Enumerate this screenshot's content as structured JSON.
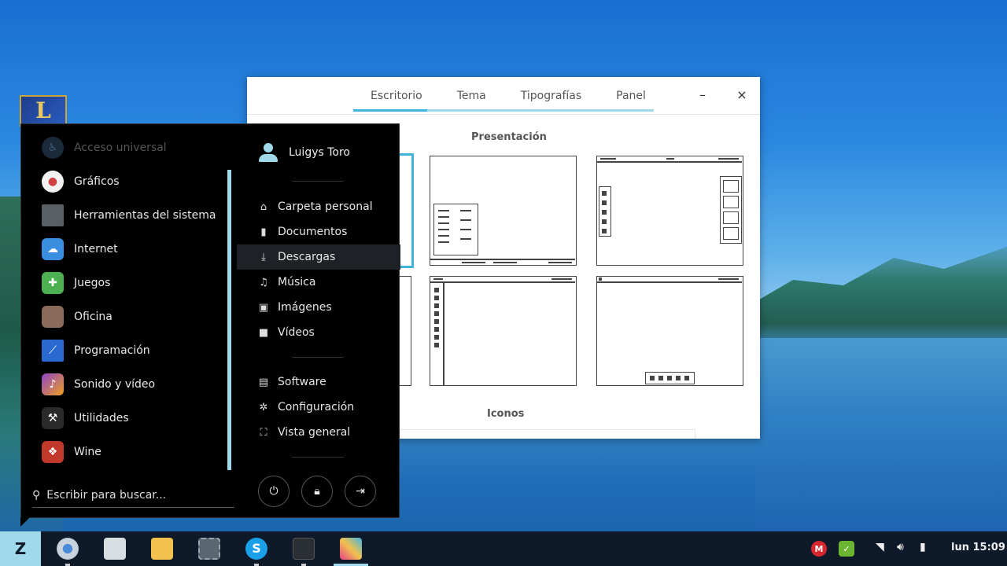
{
  "window": {
    "tabs": [
      "Escritorio",
      "Tema",
      "Tipografías",
      "Panel"
    ],
    "minimize": "–",
    "close": "×",
    "section_layout": "Presentación",
    "section_icons": "Iconos"
  },
  "menu": {
    "categories": [
      {
        "label": "Acceso universal",
        "icon": "accessibility-icon",
        "color": "#1b2a3a"
      },
      {
        "label": "Gráficos",
        "icon": "palette-icon",
        "color": "#f2f2f2"
      },
      {
        "label": "Herramientas del sistema",
        "icon": "monitor-icon",
        "color": "#5a5f66"
      },
      {
        "label": "Internet",
        "icon": "cloud-icon",
        "color": "#3a8ee0"
      },
      {
        "label": "Juegos",
        "icon": "gamepad-icon",
        "color": "#4caf50"
      },
      {
        "label": "Oficina",
        "icon": "briefcase-icon",
        "color": "#8a6a5a"
      },
      {
        "label": "Programación",
        "icon": "code-icon",
        "color": "#2a6ad0"
      },
      {
        "label": "Sonido y vídeo",
        "icon": "media-icon",
        "color": "#8e44c8"
      },
      {
        "label": "Utilidades",
        "icon": "tools-icon",
        "color": "#2a2a2a"
      },
      {
        "label": "Wine",
        "icon": "wine-icon",
        "color": "#c0392b"
      }
    ],
    "search_placeholder": "Escribir para buscar...",
    "user_name": "Luigys Toro",
    "places": [
      {
        "label": "Carpeta personal",
        "icon": "home-icon",
        "glyph": "⌂"
      },
      {
        "label": "Documentos",
        "icon": "document-icon",
        "glyph": "▮"
      },
      {
        "label": "Descargas",
        "icon": "download-icon",
        "glyph": "⤓"
      },
      {
        "label": "Música",
        "icon": "music-icon",
        "glyph": "♫"
      },
      {
        "label": "Imágenes",
        "icon": "image-icon",
        "glyph": "▣"
      },
      {
        "label": "Vídeos",
        "icon": "video-icon",
        "glyph": "■"
      }
    ],
    "system": [
      {
        "label": "Software",
        "icon": "bag-icon",
        "glyph": "▤"
      },
      {
        "label": "Configuración",
        "icon": "gear-icon",
        "glyph": "✲"
      },
      {
        "label": "Vista general",
        "icon": "overview-icon",
        "glyph": "⛶"
      }
    ],
    "power_buttons": [
      "power-icon",
      "lock-icon",
      "logout-icon"
    ]
  },
  "taskbar": {
    "clock": "lun 15:09",
    "tray_mega": "M"
  }
}
